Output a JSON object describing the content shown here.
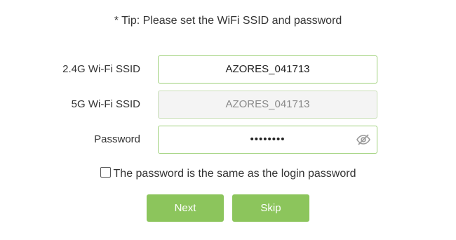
{
  "tip": "* Tip: Please set the WiFi SSID and password",
  "fields": {
    "ssid_24g": {
      "label": "2.4G Wi-Fi SSID",
      "value": "AZORES_041713"
    },
    "ssid_5g": {
      "label": "5G Wi-Fi SSID",
      "value": "AZORES_041713",
      "disabled": true
    },
    "password": {
      "label": "Password",
      "value": "••••••••",
      "toggle_icon": "eye-off-icon"
    }
  },
  "same_password_checkbox": {
    "label": "The password is the same as the login password",
    "checked": false
  },
  "buttons": {
    "next": "Next",
    "skip": "Skip"
  },
  "colors": {
    "accent": "#8cc55c",
    "field_border": "#9fd17b",
    "disabled_bg": "#f4f4f4"
  }
}
